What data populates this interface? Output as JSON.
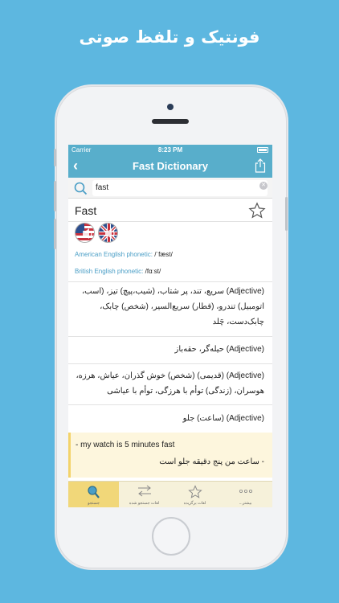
{
  "promo": {
    "title": "فونتیک و تلفظ صوتی"
  },
  "status": {
    "carrier": "Carrier",
    "time": "8:23 PM"
  },
  "nav": {
    "title": "Fast Dictionary"
  },
  "search": {
    "value": "fast"
  },
  "entry": {
    "word": "Fast",
    "american_label": "American English phonetic:",
    "american_ipa": "/ˈfæst/",
    "british_label": "British English phonetic:",
    "british_ipa": "/fɑːst/",
    "meanings": [
      "(Adjective) سریع، تند، پر شتاب، (شیب،پیچ) تیز، (اسب، اتومبیل) تندرو، (قطار) سریع‌السیر، (شخص) چابک، چابک‌دست، چَلد",
      "(Adjective) حیله‌گر، حقه‌باز",
      "(Adjective) (قدیمی) (شخص) خوش گذران، عیاش، هرزه، هوسران، (زندگی) توأم با هرزگی، توأم با عیاشی",
      "(Adjective) (ساعت) جلو"
    ],
    "example_en": "- my watch is 5 minutes fast",
    "example_fa": "- ساعت من پنج دقیقه جلو است"
  },
  "tabs": [
    {
      "label": "جستجو",
      "icon": "search-icon"
    },
    {
      "label": "لغات جستجو شده",
      "icon": "history-arrows-icon"
    },
    {
      "label": "لغات برگزیده",
      "icon": "star-icon"
    },
    {
      "label": "بیشتر...",
      "icon": "more-dots-icon"
    }
  ],
  "colors": {
    "background": "#5db7e0",
    "navbar": "#58aecb",
    "accent": "#4a9ec6",
    "example_bg": "#fdf6dd",
    "tab_active": "#f1d779"
  }
}
